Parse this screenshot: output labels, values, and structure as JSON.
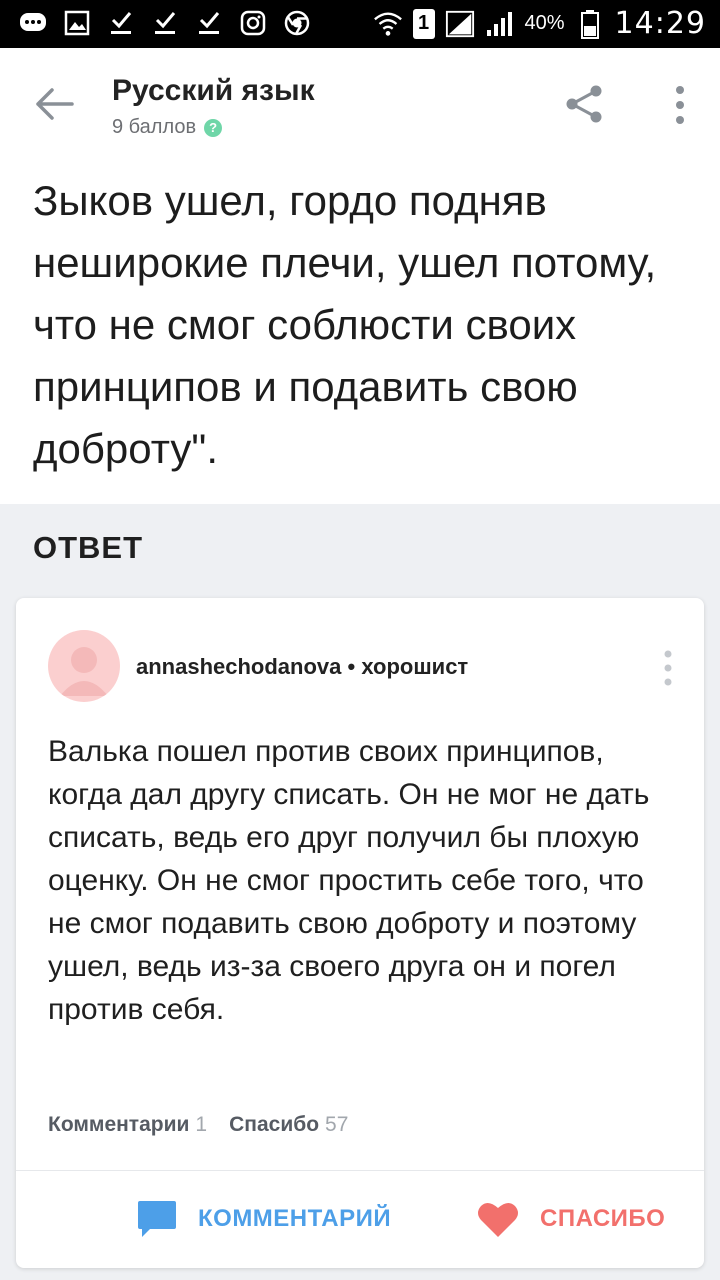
{
  "status_bar": {
    "battery": "40%",
    "time": "14:29",
    "sim_slot": "1",
    "icons": [
      "message-icon",
      "image-icon",
      "download-icon",
      "download-icon",
      "download-icon",
      "instagram-icon",
      "chrome-icon"
    ]
  },
  "header": {
    "title": "Русский язык",
    "points": "9 баллов",
    "help_symbol": "?"
  },
  "question": {
    "text": "Зыков ушел, гордо подняв неширокие плечи, ушел потому, что не смог соблюсти своих принципов и подавить свою доброту\"."
  },
  "answer_section": {
    "heading": "ОТВЕТ"
  },
  "answer": {
    "author": "annashechodanova",
    "separator": " • ",
    "rank": "хорошист",
    "text": "Валька пошел против своих принципов, когда дал другу списать. Он не мог не дать списать, ведь его друг получил бы плохую оценку. Он не смог простить себе того, что не смог подавить свою доброту и поэтому ушел, ведь из-за своего друга он и погел против себя.",
    "comments_label": "Комментарии",
    "comments_count": "1",
    "thanks_label": "Спасибо",
    "thanks_count": "57",
    "comment_button": "КОММЕНТАРИЙ",
    "thanks_button": "СПАСИБО"
  },
  "colors": {
    "accent_blue": "#4d9fe8",
    "accent_red": "#f2706c",
    "help_green": "#6fd6a8"
  }
}
